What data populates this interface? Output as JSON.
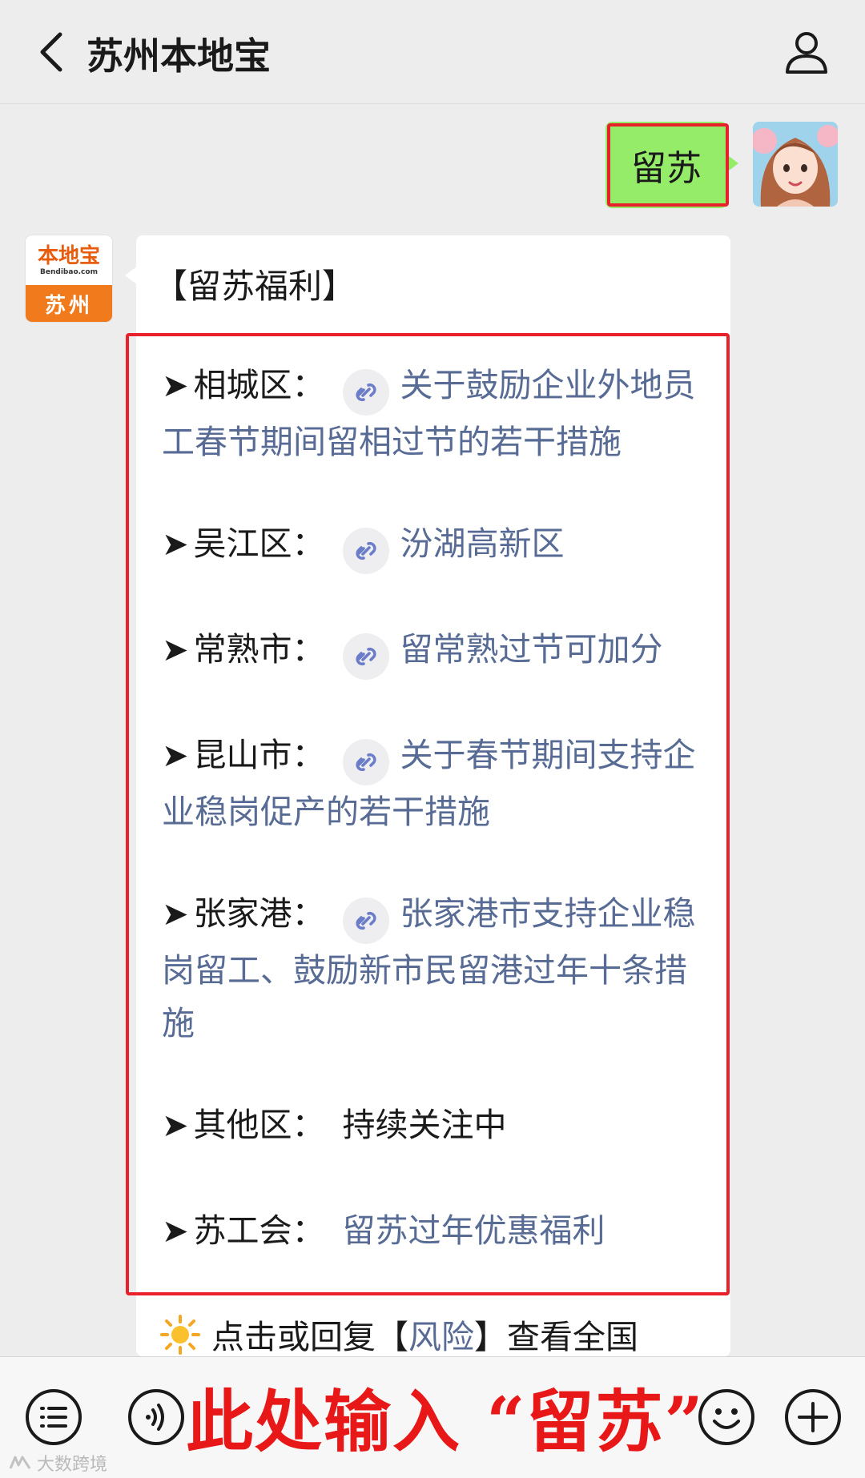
{
  "header": {
    "title": "苏州本地宝"
  },
  "sent_message": {
    "text": "留苏"
  },
  "official_account": {
    "avatar_brand": "本地宝",
    "avatar_domain": "Bendibao.com",
    "avatar_city": "苏州"
  },
  "received_message": {
    "heading": "【留苏福利】",
    "items": [
      {
        "label": "相城区：",
        "has_icon": true,
        "text": "关于鼓励企业外地员工春节期间留相过节的若干措施",
        "is_link": true
      },
      {
        "label": "吴江区：",
        "has_icon": true,
        "text": "汾湖高新区",
        "is_link": true
      },
      {
        "label": "常熟市：",
        "has_icon": true,
        "text": "留常熟过节可加分",
        "is_link": true
      },
      {
        "label": "昆山市：",
        "has_icon": true,
        "text": "关于春节期间支持企业稳岗促产的若干措施",
        "is_link": true
      },
      {
        "label": "张家港：",
        "has_icon": true,
        "text": "张家港市支持企业稳岗留工、鼓励新市民留港过年十条措施",
        "is_link": true
      },
      {
        "label": "其他区：",
        "has_icon": false,
        "text": "持续关注中",
        "is_link": false
      },
      {
        "label": "苏工会：",
        "has_icon": false,
        "text": "留苏过年优惠福利",
        "is_link": true
      }
    ],
    "arrow": "➤",
    "tip": {
      "prefix": "点击或回复【",
      "link": "风险",
      "suffix": "】查看全国"
    }
  },
  "input_bar": {
    "overlay_text": "此处输入 “留苏”",
    "watermark": "大数跨境"
  },
  "colors": {
    "sent_bubble": "#95ec69",
    "link": "#576b95",
    "highlight": "#e8202a",
    "background": "#ededed"
  }
}
